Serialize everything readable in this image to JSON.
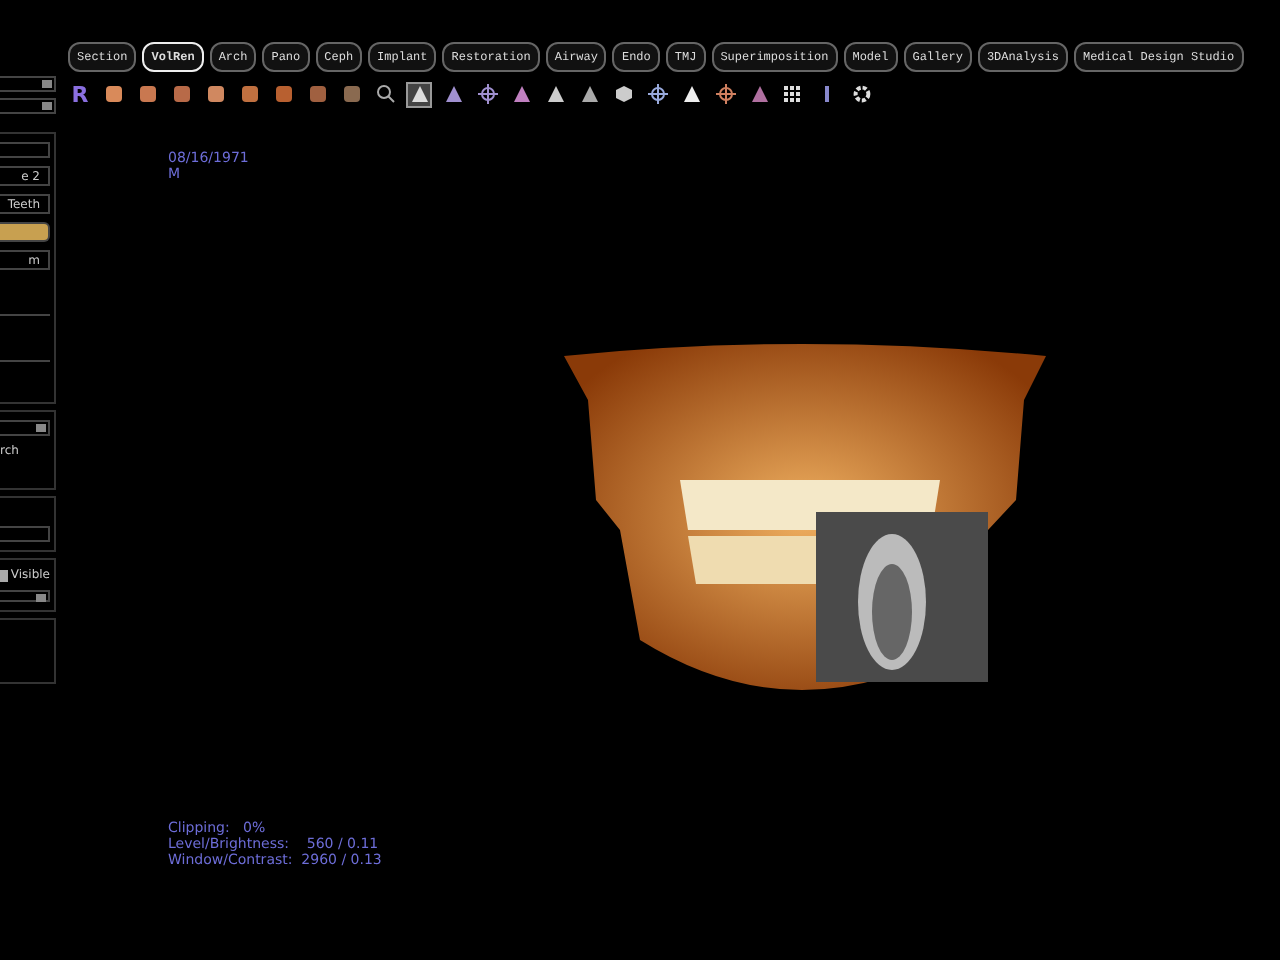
{
  "tabs": [
    {
      "label": "Section",
      "selected": false
    },
    {
      "label": "VolRen",
      "selected": true
    },
    {
      "label": "Arch",
      "selected": false
    },
    {
      "label": "Pano",
      "selected": false
    },
    {
      "label": "Ceph",
      "selected": false
    },
    {
      "label": "Implant",
      "selected": false
    },
    {
      "label": "Restoration",
      "selected": false
    },
    {
      "label": "Airway",
      "selected": false
    },
    {
      "label": "Endo",
      "selected": false
    },
    {
      "label": "TMJ",
      "selected": false
    },
    {
      "label": "Superimposition",
      "selected": false
    },
    {
      "label": "Model",
      "selected": false
    },
    {
      "label": "Gallery",
      "selected": false
    },
    {
      "label": "3DAnalysis",
      "selected": false
    },
    {
      "label": "Medical Design Studio",
      "selected": false
    }
  ],
  "toolbar": {
    "reset_label": "R",
    "tools": [
      {
        "selected": false
      },
      {
        "selected": false
      },
      {
        "selected": false
      },
      {
        "selected": false
      },
      {
        "selected": false
      },
      {
        "selected": false
      },
      {
        "selected": false
      },
      {
        "selected": false
      },
      {
        "selected": false
      },
      {
        "selected": true
      },
      {
        "selected": false
      },
      {
        "selected": false
      },
      {
        "selected": false
      },
      {
        "selected": false
      },
      {
        "selected": false
      },
      {
        "selected": false
      },
      {
        "selected": false
      },
      {
        "selected": false
      },
      {
        "selected": false
      },
      {
        "selected": false
      },
      {
        "selected": false
      },
      {
        "selected": false
      },
      {
        "selected": false
      }
    ]
  },
  "left_panel": {
    "items": [
      {
        "label": "e 2",
        "selected": false
      },
      {
        "label": "Teeth",
        "selected": false
      },
      {
        "selected": true
      },
      {
        "label": "m",
        "selected": false
      }
    ],
    "arch_label": "rch",
    "visible": {
      "label": "Visible",
      "checked": true
    }
  },
  "patient": {
    "dob": "08/16/1971",
    "sex": "M"
  },
  "render_info": [
    "Clipping:   0%",
    "Level/Brightness:    560 / 0.11",
    "Window/Contrast:  2960 / 0.13"
  ]
}
